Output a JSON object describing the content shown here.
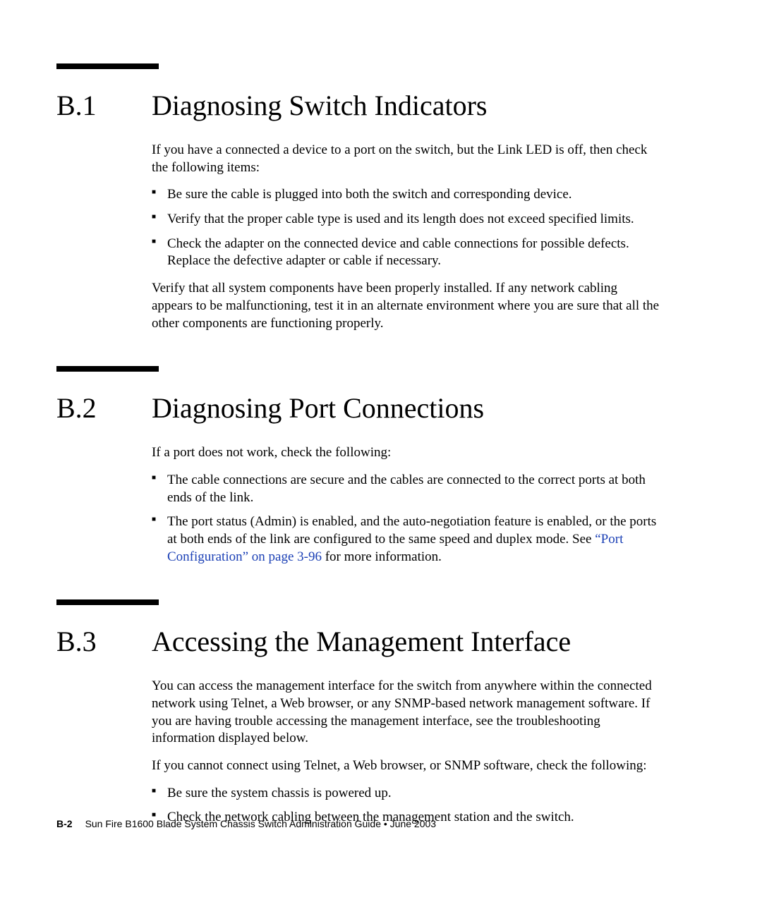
{
  "sections": [
    {
      "rule": true,
      "num": "B.1",
      "title": "Diagnosing Switch Indicators",
      "blocks": [
        {
          "type": "para",
          "text": "If you have a connected a device to a port on the switch, but the Link LED is off, then check the following items:"
        },
        {
          "type": "bullets",
          "items": [
            "Be sure the cable is plugged into both the switch and corresponding device.",
            "Verify that the proper cable type is used and its length does not exceed specified limits.",
            "Check the adapter on the connected device and cable connections for possible defects. Replace the defective adapter or cable if necessary."
          ]
        },
        {
          "type": "para",
          "text": "Verify that all system components have been properly installed. If any network cabling appears to be malfunctioning, test it in an alternate environment where you are sure that all the other components are functioning properly."
        }
      ]
    },
    {
      "rule": true,
      "num": "B.2",
      "title": "Diagnosing Port Connections",
      "blocks": [
        {
          "type": "para",
          "text": "If a port does not work, check the following:"
        },
        {
          "type": "bullets",
          "items": [
            "The cable connections are secure and the cables are connected to the correct ports at both ends of the link.",
            {
              "pre": "The port status (Admin) is enabled, and the auto-negotiation feature is enabled, or the ports at both ends of the link are configured to the same speed and duplex mode. See ",
              "link": "“Port Configuration” on page 3-96",
              "post": " for more information."
            }
          ]
        }
      ]
    },
    {
      "rule": true,
      "num": "B.3",
      "title": "Accessing the Management Interface",
      "blocks": [
        {
          "type": "para",
          "text": "You can access the management interface for the switch from anywhere within the connected network using Telnet, a Web browser, or any SNMP-based network management software. If you are having trouble accessing the management interface, see the troubleshooting information displayed below."
        },
        {
          "type": "para",
          "text": "If you cannot connect using Telnet, a Web browser, or SNMP software, check the following:"
        },
        {
          "type": "bullets",
          "items": [
            "Be sure the system chassis is powered up.",
            "Check the network cabling between the management station and the switch."
          ]
        }
      ]
    }
  ],
  "footer": {
    "page": "B-2",
    "text": "Sun Fire B1600 Blade System Chassis Switch Administration Guide • June 2003"
  }
}
